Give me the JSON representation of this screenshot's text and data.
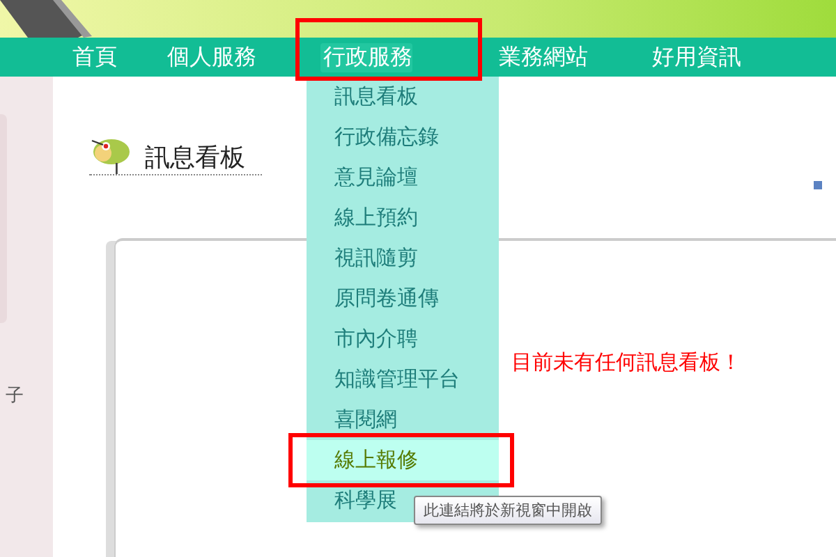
{
  "nav": [
    {
      "label": "首頁",
      "selected": false
    },
    {
      "label": "個人服務",
      "selected": false
    },
    {
      "label": "行政服務",
      "selected": true
    },
    {
      "label": "業務網站",
      "selected": false
    },
    {
      "label": "好用資訊",
      "selected": false
    }
  ],
  "dropdown": {
    "items": [
      {
        "label": "訊息看板",
        "selected": false
      },
      {
        "label": "行政備忘錄",
        "selected": false
      },
      {
        "label": "意見論壇",
        "selected": false
      },
      {
        "label": "線上預約",
        "selected": false
      },
      {
        "label": "視訊隨剪",
        "selected": false
      },
      {
        "label": "原問卷通傳",
        "selected": false
      },
      {
        "label": "市內介聘",
        "selected": false
      },
      {
        "label": "知識管理平台",
        "selected": false
      },
      {
        "label": "喜閱網",
        "selected": false
      },
      {
        "label": "線上報修",
        "selected": true
      },
      {
        "label": "科學展",
        "selected": false
      }
    ]
  },
  "page_title": "訊息看板",
  "message": "目前未有任何訊息看板！",
  "tooltip": "此連結將於新視窗中開啟",
  "sidebar_fragment": "子"
}
